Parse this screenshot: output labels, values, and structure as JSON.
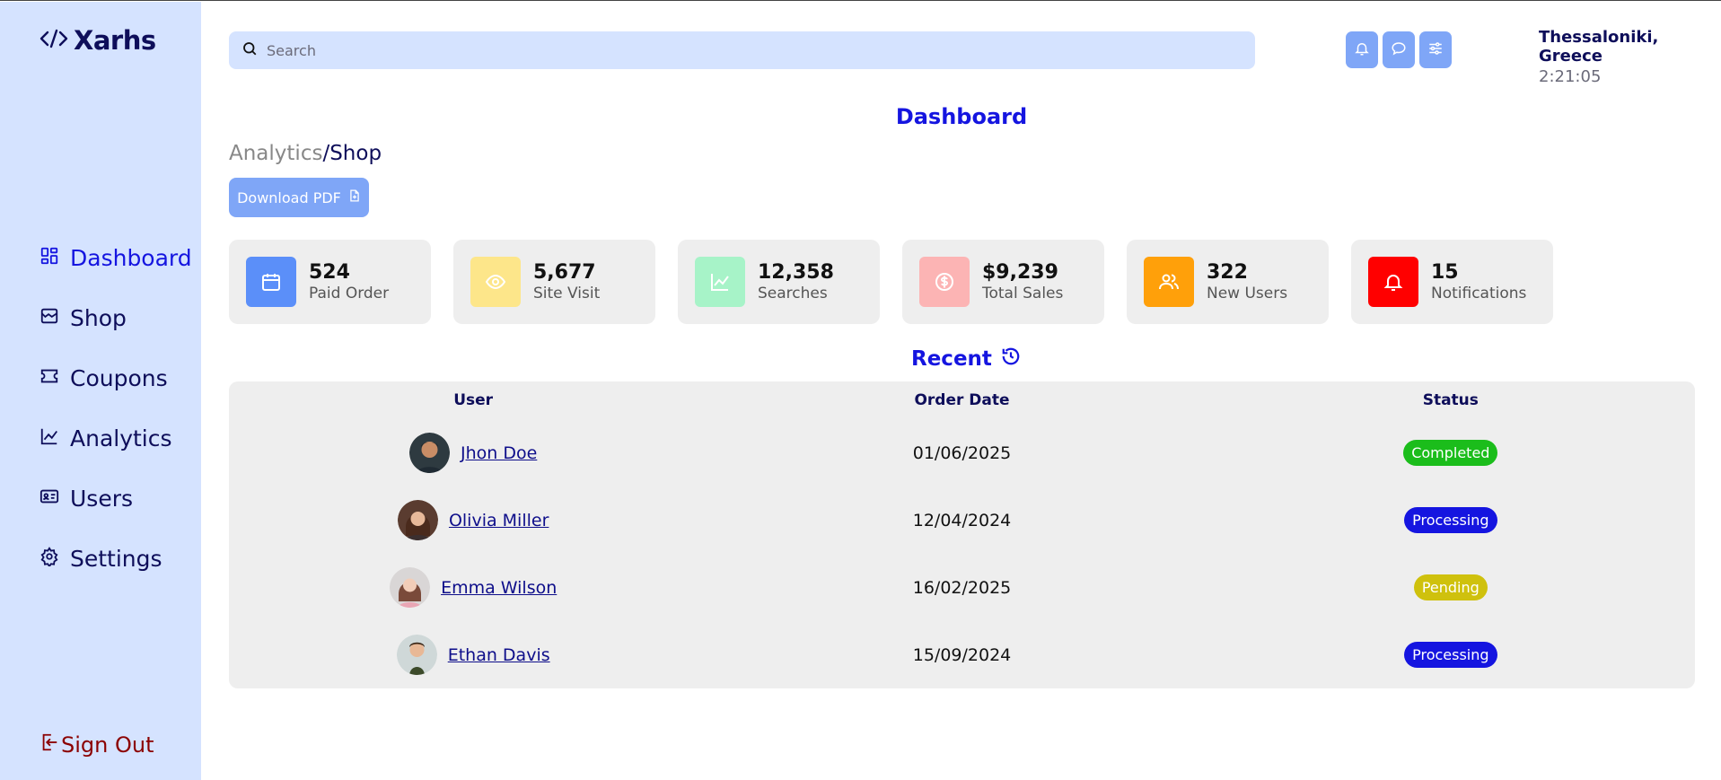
{
  "brand": {
    "name": "Xarhs"
  },
  "sidebar": {
    "items": [
      {
        "label": "Dashboard",
        "icon": "dashboard-icon",
        "active": true
      },
      {
        "label": "Shop",
        "icon": "shop-icon",
        "active": false
      },
      {
        "label": "Coupons",
        "icon": "coupon-icon",
        "active": false
      },
      {
        "label": "Analytics",
        "icon": "analytics-icon",
        "active": false
      },
      {
        "label": "Users",
        "icon": "users-icon",
        "active": false
      },
      {
        "label": "Settings",
        "icon": "gear-icon",
        "active": false
      }
    ],
    "signout_label": "Sign Out"
  },
  "search": {
    "placeholder": "Search"
  },
  "toolbar": {
    "icons": [
      "bell-icon",
      "chat-icon",
      "sliders-icon"
    ]
  },
  "location": {
    "city": "Thessaloniki, Greece",
    "time": "2:21:05"
  },
  "page": {
    "title": "Dashboard",
    "breadcrumb": {
      "parent": "Analytics",
      "separator": "/",
      "current": "Shop"
    },
    "download_label": "Download PDF"
  },
  "stats": [
    {
      "value": "524",
      "label": "Paid Order",
      "icon": "calendar-icon",
      "color": "#5b8ff9"
    },
    {
      "value": "5,677",
      "label": "Site Visit",
      "icon": "eye-icon",
      "color": "#fde68a"
    },
    {
      "value": "12,358",
      "label": "Searches",
      "icon": "chart-icon",
      "color": "#a7f3c8"
    },
    {
      "value": "$9,239",
      "label": "Total Sales",
      "icon": "dollar-icon",
      "color": "#fcb4b4"
    },
    {
      "value": "322",
      "label": "New Users",
      "icon": "users-icon",
      "color": "#ffa00a"
    },
    {
      "value": "15",
      "label": "Notifications",
      "icon": "bell-icon",
      "color": "#ff0000"
    }
  ],
  "recent": {
    "title": "Recent",
    "columns": [
      "User",
      "Order Date",
      "Status"
    ],
    "rows": [
      {
        "user": "Jhon Doe",
        "date": "01/06/2025",
        "status": "Completed",
        "status_color": "#1bbd1b"
      },
      {
        "user": "Olivia Miller",
        "date": "12/04/2024",
        "status": "Processing",
        "status_color": "#1515e0"
      },
      {
        "user": "Emma Wilson",
        "date": "16/02/2025",
        "status": "Pending",
        "status_color": "#cfc10d"
      },
      {
        "user": "Ethan Davis",
        "date": "15/09/2024",
        "status": "Processing",
        "status_color": "#1515e0"
      }
    ]
  }
}
